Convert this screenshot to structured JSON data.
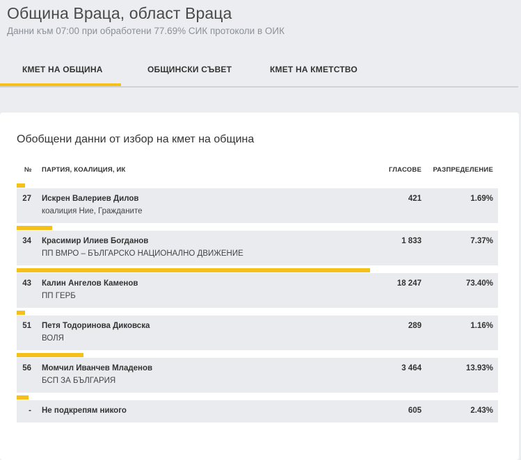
{
  "header": {
    "title": "Община Враца, област Враца",
    "subtitle": "Данни към 07:00 при обработени 77.69% СИК протоколи в ОИК"
  },
  "tabs": [
    {
      "label": "КМЕТ НА ОБЩИНА"
    },
    {
      "label": "ОБЩИНСКИ СЪВЕТ"
    },
    {
      "label": "КМЕТ НА КМЕТСТВО"
    }
  ],
  "active_tab": 0,
  "accent_color": "#f5c01a",
  "card": {
    "title": "Обобщени данни от избор на кмет на община",
    "columns": {
      "no": "№",
      "party": "ПАРТИЯ, КОАЛИЦИЯ, ИК",
      "votes": "ГЛАСОВЕ",
      "share": "РАЗПРЕДЕЛЕНИЕ"
    },
    "rows": [
      {
        "no": "27",
        "name": "Искрен Валериев Дилов",
        "party": "коалиция Ние, Гражданите",
        "votes": "421",
        "share": "1.69%",
        "share_value": 1.69
      },
      {
        "no": "34",
        "name": "Красимир Илиев Богданов",
        "party": "ПП ВМРО – БЪЛГАРСКО НАЦИОНАЛНО ДВИЖЕНИЕ",
        "votes": "1 833",
        "share": "7.37%",
        "share_value": 7.37
      },
      {
        "no": "43",
        "name": "Калин Ангелов Каменов",
        "party": "ПП ГЕРБ",
        "votes": "18 247",
        "share": "73.40%",
        "share_value": 73.4
      },
      {
        "no": "51",
        "name": "Петя Тодоринова Диковска",
        "party": "ВОЛЯ",
        "votes": "289",
        "share": "1.16%",
        "share_value": 1.16
      },
      {
        "no": "56",
        "name": "Момчил Иванчев Младенов",
        "party": "БСП ЗА БЪЛГАРИЯ",
        "votes": "3 464",
        "share": "13.93%",
        "share_value": 13.93
      },
      {
        "no": "-",
        "name": "Не подкрепям никого",
        "party": "",
        "votes": "605",
        "share": "2.43%",
        "share_value": 2.43
      }
    ]
  }
}
